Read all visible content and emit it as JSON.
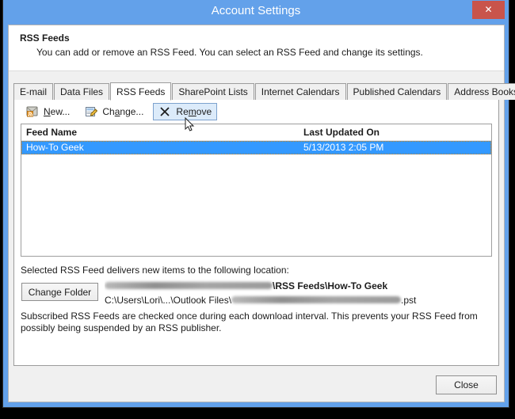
{
  "window": {
    "title": "Account Settings",
    "close_label": "✕",
    "accent_color": "#63a1ea",
    "close_button_color": "#c9544b"
  },
  "header": {
    "title": "RSS Feeds",
    "description": "You can add or remove an RSS Feed. You can select an RSS Feed and change its settings."
  },
  "tabs": [
    {
      "label": "E-mail",
      "active": false
    },
    {
      "label": "Data Files",
      "active": false
    },
    {
      "label": "RSS Feeds",
      "active": true
    },
    {
      "label": "SharePoint Lists",
      "active": false
    },
    {
      "label": "Internet Calendars",
      "active": false
    },
    {
      "label": "Published Calendars",
      "active": false
    },
    {
      "label": "Address Books",
      "active": false
    }
  ],
  "toolbar": {
    "new": {
      "label": "New...",
      "accel": "N",
      "icon": "rss-envelope-icon",
      "hover": false
    },
    "change": {
      "label": "Change...",
      "accel": "a",
      "icon": "edit-document-icon",
      "hover": false
    },
    "remove": {
      "label": "Remove",
      "accel": "m",
      "icon": "x-mark-icon",
      "hover": true
    }
  },
  "list": {
    "columns": [
      {
        "key": "name",
        "label": "Feed Name"
      },
      {
        "key": "date",
        "label": "Last Updated On"
      }
    ],
    "rows": [
      {
        "name": "How-To Geek",
        "date": "5/13/2013 2:05 PM",
        "selected": true
      }
    ],
    "selection_color": "#3399ff"
  },
  "location": {
    "label": "Selected RSS Feed delivers new items to the following location:",
    "change_folder_label": "Change Folder",
    "path_line1_suffix": "\\RSS Feeds\\How-To Geek",
    "path_line2_prefix": "C:\\Users\\Lori\\...\\Outlook Files\\",
    "path_line2_suffix": ".pst"
  },
  "note": {
    "text": "Subscribed RSS Feeds are checked once during each download interval. This prevents your RSS Feed from possibly being suspended by an RSS publisher."
  },
  "footer": {
    "close_label": "Close"
  }
}
